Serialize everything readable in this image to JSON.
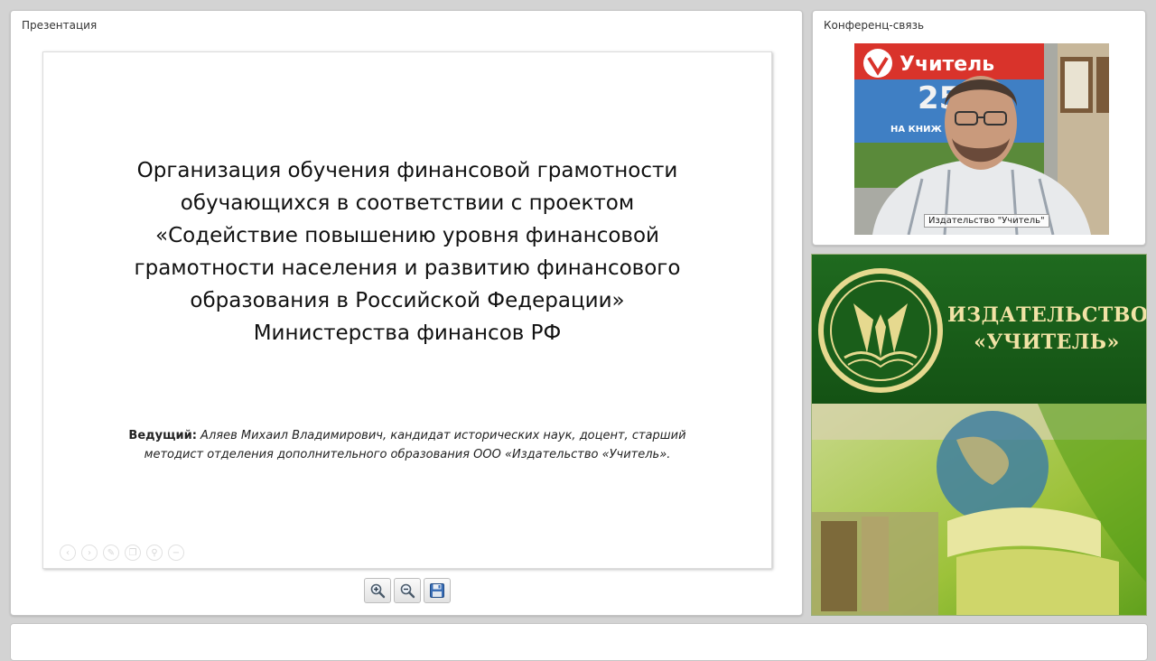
{
  "presentation_panel": {
    "title": "Презентация"
  },
  "slide": {
    "title_lines": [
      "Организация обучения финансовой грамотности",
      "обучающихся в соответствии с проектом",
      "«Содействие повышению уровня финансовой",
      "грамотности населения и развитию финансового",
      "образования в Российской Федерации»",
      "Министерства финансов РФ"
    ],
    "presenter_label": "Ведущий:",
    "presenter_line1": " Аляев Михаил Владимирович, кандидат исторических наук, доцент, старший",
    "presenter_line2": "методист отделения дополнительного образования ООО «Издательство «Учитель»."
  },
  "slide_nav_icons": [
    "prev-icon",
    "next-icon",
    "pen-icon",
    "copy-icon",
    "zoom-icon",
    "minus-icon"
  ],
  "toolbar": {
    "buttons": [
      {
        "name": "zoom-in-button",
        "icon": "zoom-in-icon"
      },
      {
        "name": "zoom-out-button",
        "icon": "zoom-out-icon"
      },
      {
        "name": "save-button",
        "icon": "floppy-disk-icon"
      }
    ]
  },
  "conference_panel": {
    "title": "Конференц-связь",
    "video_label": "Издательство \"Учитель\""
  },
  "banner": {
    "line1": "ИЗДАТЕЛЬСТВО",
    "line2": "«УЧИТЕЛЬ»",
    "colors": {
      "green": "#1f6a1f",
      "gold": "#f2e3a6"
    }
  }
}
